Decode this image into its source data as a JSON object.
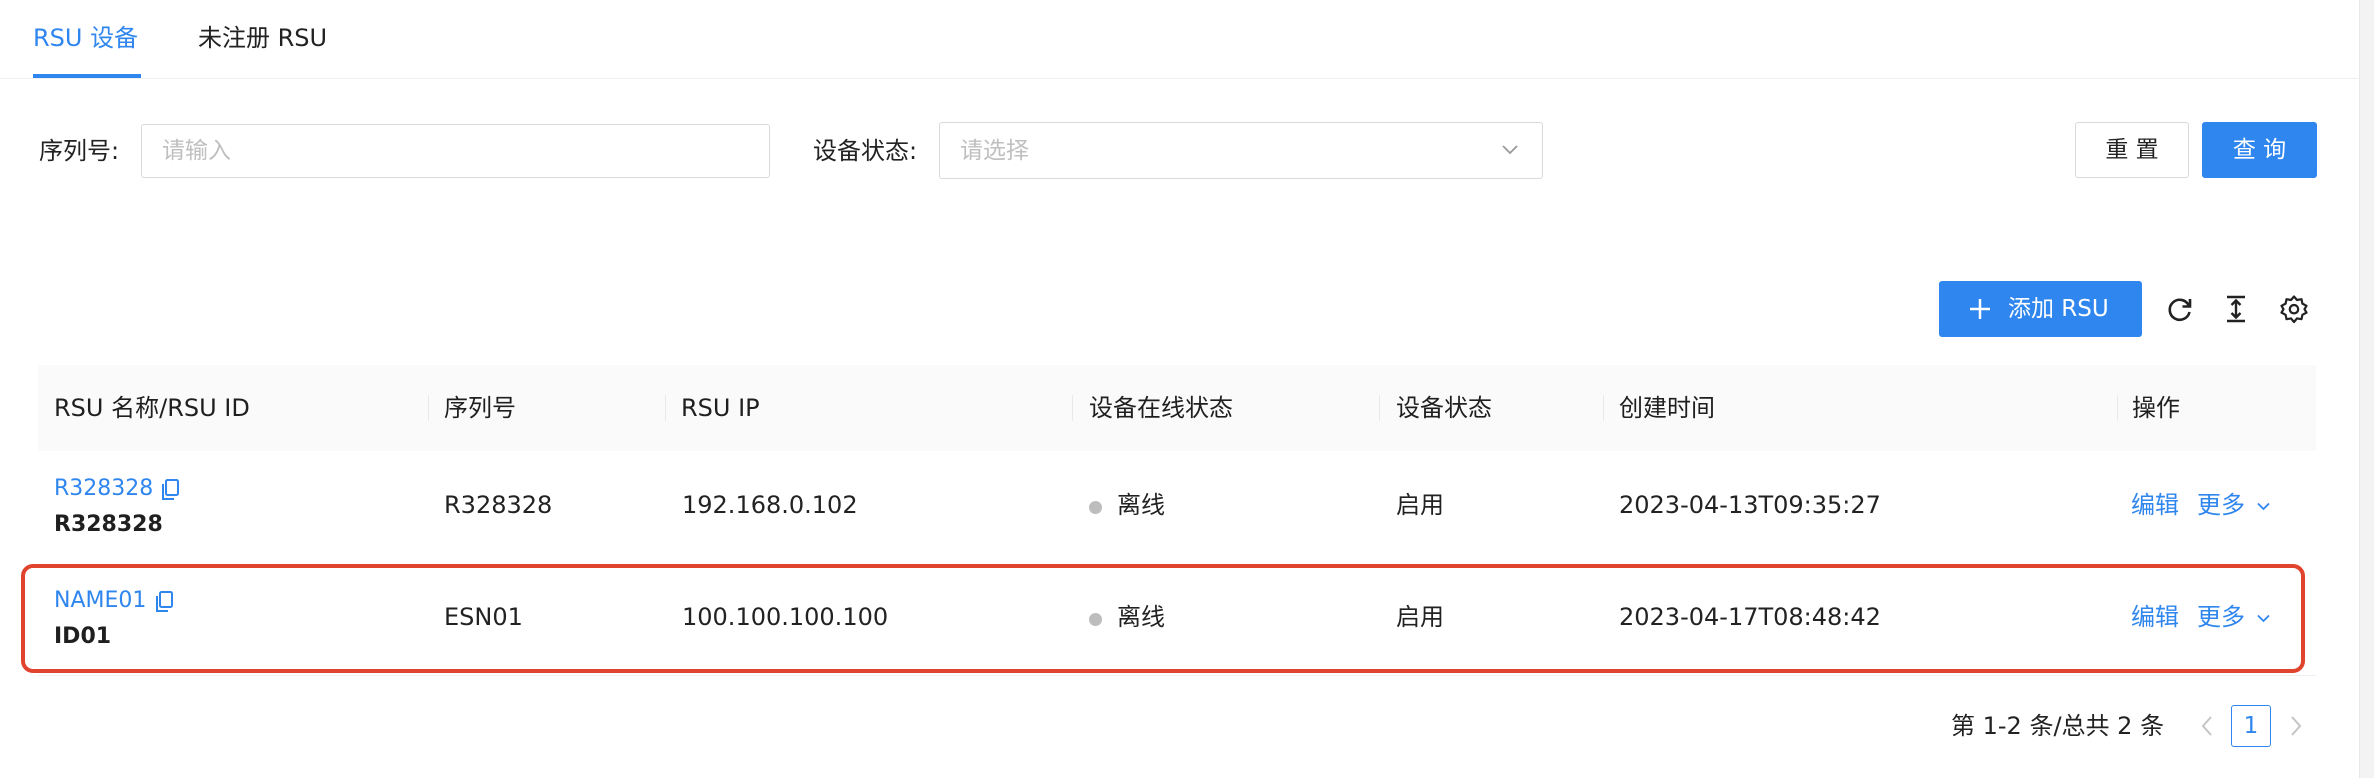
{
  "tabs": [
    {
      "label": "RSU 设备",
      "active": true
    },
    {
      "label": "未注册 RSU",
      "active": false
    }
  ],
  "filters": {
    "serial_label": "序列号:",
    "serial_placeholder": "请输入",
    "status_label": "设备状态:",
    "status_placeholder": "请选择",
    "reset_label": "重 置",
    "query_label": "查 询"
  },
  "toolbar": {
    "add_label": "添加 RSU",
    "icons": [
      "refresh-icon",
      "column-height-icon",
      "settings-icon"
    ]
  },
  "table": {
    "columns": [
      "RSU 名称/RSU ID",
      "序列号",
      "RSU IP",
      "设备在线状态",
      "设备状态",
      "创建时间",
      "操作"
    ],
    "rows": [
      {
        "name": "R328328",
        "id": "R328328",
        "serial": "R328328",
        "ip": "192.168.0.102",
        "online_status": "离线",
        "device_status": "启用",
        "created": "2023-04-13T09:35:27",
        "edit": "编辑",
        "more": "更多"
      },
      {
        "name": "NAME01",
        "id": "ID01",
        "serial": "ESN01",
        "ip": "100.100.100.100",
        "online_status": "离线",
        "device_status": "启用",
        "created": "2023-04-17T08:48:42",
        "edit": "编辑",
        "more": "更多"
      }
    ]
  },
  "pagination": {
    "summary": "第 1-2 条/总共 2 条",
    "current_page": "1"
  },
  "colors": {
    "primary": "#2f86ee",
    "highlight": "#e0442e",
    "offline_dot": "#bdbdbd"
  }
}
